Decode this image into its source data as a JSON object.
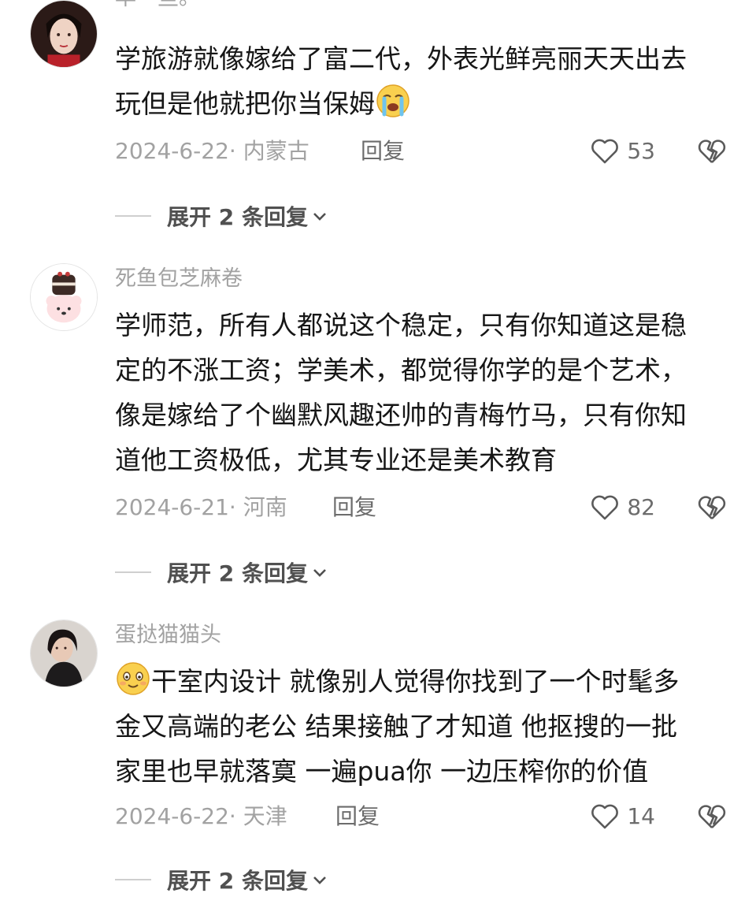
{
  "top_cut_text": "早一些。",
  "comments": [
    {
      "username": "",
      "avatar": "avatar-woman-red-dress",
      "lines": [
        "学旅游就像嫁给了富二代，外表光鲜亮丽天天出去",
        "玩但是他就把你当保姆"
      ],
      "trailing_emoji": "crying-emoji",
      "date": "2024-6-22",
      "location": "内蒙古",
      "reply_label": "回复",
      "likes": "53",
      "expand_label": "展开 2 条回复"
    },
    {
      "username": "死鱼包芝麻卷",
      "avatar": "avatar-dog-with-cake",
      "lines": [
        "学师范，所有人都说这个稳定，只有你知道这是稳",
        "定的不涨工资；学美术，都觉得你学的是个艺术，",
        "像是嫁给了个幽默风趣还帅的青梅竹马，只有你知",
        "道他工资极低，尤其专业还是美术教育"
      ],
      "date": "2024-6-21",
      "location": "河南",
      "reply_label": "回复",
      "likes": "82",
      "expand_label": "展开 2 条回复"
    },
    {
      "username": "蛋挞猫猫头",
      "avatar": "avatar-woman-portrait",
      "leading_emoji": "smiling-emoji",
      "lines": [
        "干室内设计 就像别人觉得你找到了一个时髦多",
        "金又高端的老公 结果接触了才知道 他抠搜的一批",
        "家里也早就落寞 一遍pua你 一边压榨你的价值"
      ],
      "date": "2024-6-22",
      "location": "天津",
      "reply_label": "回复",
      "likes": "14",
      "expand_label": "展开 2 条回复"
    }
  ],
  "colors": {
    "text": "#161616",
    "muted": "#a2a2a2",
    "action": "#6c6c6c"
  }
}
